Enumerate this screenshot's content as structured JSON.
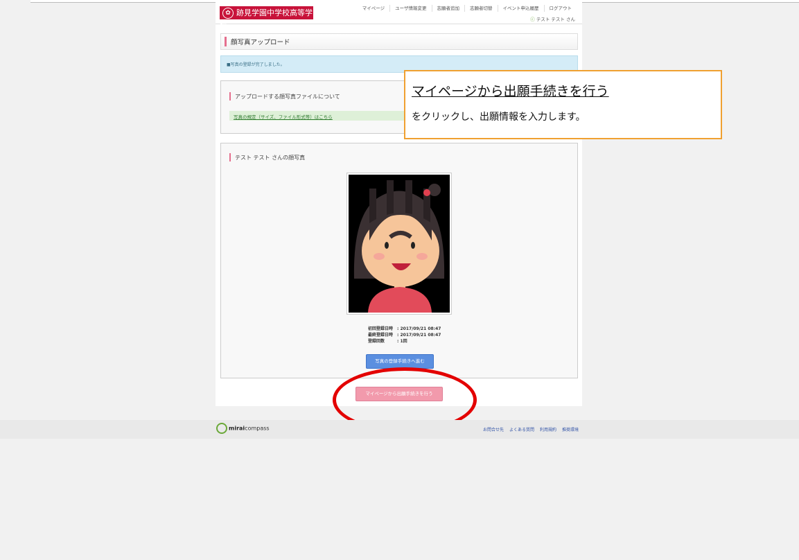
{
  "header": {
    "school_name": "跡見学園中学校高等学校",
    "nav": [
      "マイページ",
      "ユーザ情報変更",
      "志願者追加",
      "志願者切替",
      "イベント申込履歴",
      "ログアウト"
    ],
    "user_name": "テスト テスト さん"
  },
  "page_title": "顔写真アップロード",
  "notice": "■写真の登録が完了しました。",
  "upload_section": {
    "title": "アップロードする顔写真ファイルについて",
    "link": "写真の規定（サイズ、ファイル形式等）はこちら"
  },
  "photo_section": {
    "title": "テスト テスト さんの顔写真",
    "meta": [
      {
        "label": "初回登録日時",
        "value": ": 2017/09/21 08:47"
      },
      {
        "label": "最終登録日時",
        "value": ": 2017/09/21 08:47"
      },
      {
        "label": "登録回数",
        "value": ": 1回"
      }
    ],
    "button": "写真の登録手続きへ進む"
  },
  "primary_button": "マイページから出願手続きを行う",
  "callout": {
    "heading": "マイページから出願手続きを行う",
    "body": "をクリックし、出願情報を入力します。"
  },
  "footer": {
    "logo_bold": "mirai",
    "logo_rest": "compass",
    "links": [
      "お問合せ先",
      "よくある質問",
      "利用規約",
      "推奨環境"
    ]
  },
  "colors": {
    "brand": "#c8133a",
    "accent": "#e56f8e",
    "blue_button": "#5b8fe0",
    "pink_button": "#f29aac",
    "highlight": "#e30000",
    "callout_border": "#f0a030"
  }
}
